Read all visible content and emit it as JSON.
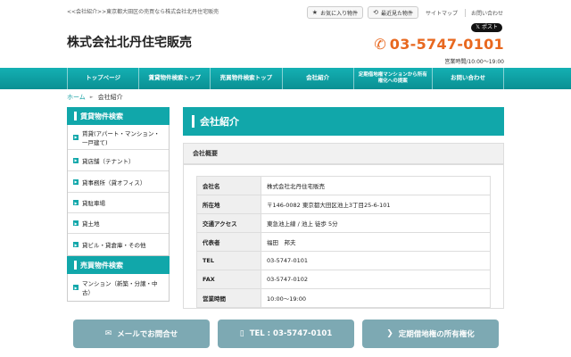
{
  "tagline": "<<会社紹介>>東京都大田区の売買なら株式会社北丹住宅販売",
  "top_links": {
    "favorites": {
      "icon": "star-icon",
      "label": "お気に入り物件"
    },
    "recent": {
      "icon": "history-icon",
      "label": "最近見た物件"
    },
    "sitemap": "サイトマップ",
    "contact": "お問い合わせ"
  },
  "header": {
    "company_name": "株式会社北丹住宅販売",
    "xpost": {
      "icon": "x-logo-icon",
      "label": "ポスト"
    },
    "phone": "03-5747-0101",
    "hours": "営業時間/10:00〜19:00"
  },
  "nav": [
    "トップページ",
    "賃貸物件検索トップ",
    "売買物件検索トップ",
    "会社紹介",
    "定期借地権マンションから所有権化への提案",
    "お問い合わせ"
  ],
  "breadcrumb": {
    "home": "ホーム",
    "sep": "►",
    "current": "会社紹介"
  },
  "sidebar": {
    "rental": {
      "heading": "賃貸物件検索",
      "items": [
        "賃貸(アパート・マンション・一戸建て)",
        "貸店舗（テナント）",
        "貸事務所（貸オフィス）",
        "貸駐車場",
        "貸土地",
        "貸ビル・貸倉庫・その他"
      ]
    },
    "sale": {
      "heading": "売買物件検索",
      "items": [
        "マンション（新築・分譲・中古）"
      ]
    }
  },
  "main": {
    "title": "会社紹介",
    "panel_title": "会社概要",
    "rows": [
      {
        "k": "会社名",
        "v": "株式会社北丹住宅販売"
      },
      {
        "k": "所在地",
        "v": "〒146-0082 東京都大田区池上3丁目25-6-101"
      },
      {
        "k": "交通アクセス",
        "v": "東急池上線 / 池上 徒歩 5分"
      },
      {
        "k": "代表者",
        "v": "福田　邦夫"
      },
      {
        "k": "TEL",
        "v": "03-5747-0101"
      },
      {
        "k": "FAX",
        "v": "03-5747-0102"
      },
      {
        "k": "営業時間",
        "v": "10:00〜19:00"
      }
    ]
  },
  "bottom_buttons": [
    {
      "icon": "mail-icon",
      "label": "メールでお問合せ"
    },
    {
      "icon": "phone-icon",
      "label": "TEL : 03-5747-0101"
    },
    {
      "icon": "chevron-right-icon",
      "label": "定期借地権の所有権化"
    }
  ],
  "colors": {
    "accent": "#11a7aa",
    "phone": "#e8681f"
  }
}
